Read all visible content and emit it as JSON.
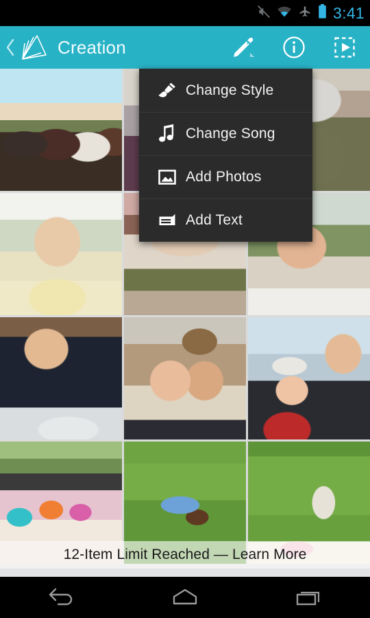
{
  "statusbar": {
    "time": "3:41",
    "time_color": "#33b5e5",
    "icons": [
      {
        "name": "volume-mute-icon",
        "label": "mute"
      },
      {
        "name": "wifi-icon",
        "label": "wifi"
      },
      {
        "name": "airplane-mode-icon",
        "label": "airplane mode"
      },
      {
        "name": "battery-icon",
        "label": "battery full"
      }
    ]
  },
  "actionbar": {
    "title": "Creation",
    "accent_color": "#28b2c6",
    "back_icon": "back-chevron-icon",
    "logo_icon": "photo-fan-logo-icon",
    "actions": [
      {
        "name": "edit-button",
        "icon": "pencil-icon",
        "label": "Edit",
        "active": true
      },
      {
        "name": "info-button",
        "icon": "info-circle-icon",
        "label": "Info"
      },
      {
        "name": "preview-button",
        "icon": "preview-play-icon",
        "label": "Preview"
      }
    ]
  },
  "edit_menu": {
    "background_color": "#2b2b2b",
    "items": [
      {
        "label": "Change Style",
        "icon": "brush-icon"
      },
      {
        "label": "Change Song",
        "icon": "music-note-icon"
      },
      {
        "label": "Add Photos",
        "icon": "image-icon"
      },
      {
        "label": "Add Text",
        "icon": "add-text-icon"
      }
    ]
  },
  "grid": {
    "columns": 3,
    "rows": 4,
    "tiles": [
      {
        "id": 1,
        "alt": "Group of men outdoors toasting with glasses at sunset"
      },
      {
        "id": 2,
        "alt": "Woman indoors, partially hidden behind menu"
      },
      {
        "id": 3,
        "alt": "Older man with grey hair and glasses in olive shirt"
      },
      {
        "id": 4,
        "alt": "Blonde woman in yellow jacket resting chin on hand"
      },
      {
        "id": 5,
        "alt": "Group of friends at a dinner table with food and wine"
      },
      {
        "id": 6,
        "alt": "Man laughing in a grassy field"
      },
      {
        "id": 7,
        "alt": "Young person wearing a wide cowboy hat"
      },
      {
        "id": 8,
        "alt": "Smiling man in dark jacket holding a swaddled baby"
      },
      {
        "id": 9,
        "alt": "Couple laughing together, man in knit cap"
      },
      {
        "id": 10,
        "alt": "Baby in striped hat and red coat held by a man"
      },
      {
        "id": 11,
        "alt": "Children in star sunglasses at an outdoor party table"
      },
      {
        "id": 12,
        "alt": "Children playing on a green lawn"
      },
      {
        "id": 13,
        "alt": "Girl sitting on grass with gift bags"
      }
    ]
  },
  "limit_banner": {
    "text": "12-Item Limit Reached — Learn More",
    "link_text": "Learn More"
  },
  "navbar": {
    "buttons": [
      {
        "name": "nav-back-button",
        "icon": "back-arrow-icon",
        "label": "Back"
      },
      {
        "name": "nav-home-button",
        "icon": "home-icon",
        "label": "Home"
      },
      {
        "name": "nav-recents-button",
        "icon": "recents-icon",
        "label": "Recents"
      }
    ]
  }
}
